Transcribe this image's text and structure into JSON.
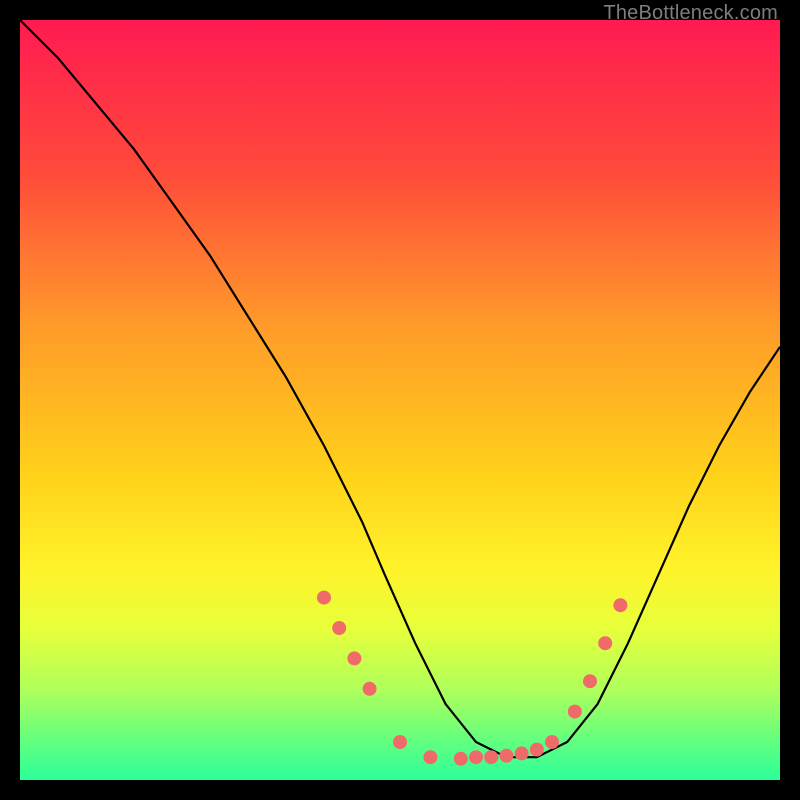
{
  "watermark": "TheBottleneck.com",
  "chart_data": {
    "type": "line",
    "title": "",
    "xlabel": "",
    "ylabel": "",
    "xlim": [
      0,
      100
    ],
    "ylim": [
      0,
      100
    ],
    "gradient_stops": [
      {
        "offset": 0,
        "color": "#ff1a52"
      },
      {
        "offset": 20,
        "color": "#ff4a3a"
      },
      {
        "offset": 40,
        "color": "#ff9a2a"
      },
      {
        "offset": 60,
        "color": "#ffd21a"
      },
      {
        "offset": 72,
        "color": "#fff22a"
      },
      {
        "offset": 80,
        "color": "#e7ff3a"
      },
      {
        "offset": 88,
        "color": "#b0ff5a"
      },
      {
        "offset": 94,
        "color": "#6cff7a"
      },
      {
        "offset": 100,
        "color": "#2cff9a"
      }
    ],
    "series": [
      {
        "name": "bottleneck-curve",
        "x": [
          0,
          5,
          10,
          15,
          20,
          25,
          30,
          35,
          40,
          45,
          48,
          52,
          56,
          60,
          64,
          68,
          72,
          76,
          80,
          84,
          88,
          92,
          96,
          100
        ],
        "y": [
          100,
          95,
          89,
          83,
          76,
          69,
          61,
          53,
          44,
          34,
          27,
          18,
          10,
          5,
          3,
          3,
          5,
          10,
          18,
          27,
          36,
          44,
          51,
          57
        ]
      }
    ],
    "markers": {
      "name": "highlight-points",
      "color": "#f06a6a",
      "radius": 7,
      "points": [
        {
          "x": 40,
          "y": 24
        },
        {
          "x": 42,
          "y": 20
        },
        {
          "x": 44,
          "y": 16
        },
        {
          "x": 46,
          "y": 12
        },
        {
          "x": 50,
          "y": 5
        },
        {
          "x": 54,
          "y": 3
        },
        {
          "x": 58,
          "y": 2.8
        },
        {
          "x": 60,
          "y": 3
        },
        {
          "x": 62,
          "y": 3
        },
        {
          "x": 64,
          "y": 3.2
        },
        {
          "x": 66,
          "y": 3.5
        },
        {
          "x": 68,
          "y": 4
        },
        {
          "x": 70,
          "y": 5
        },
        {
          "x": 73,
          "y": 9
        },
        {
          "x": 75,
          "y": 13
        },
        {
          "x": 77,
          "y": 18
        },
        {
          "x": 79,
          "y": 23
        }
      ]
    }
  }
}
